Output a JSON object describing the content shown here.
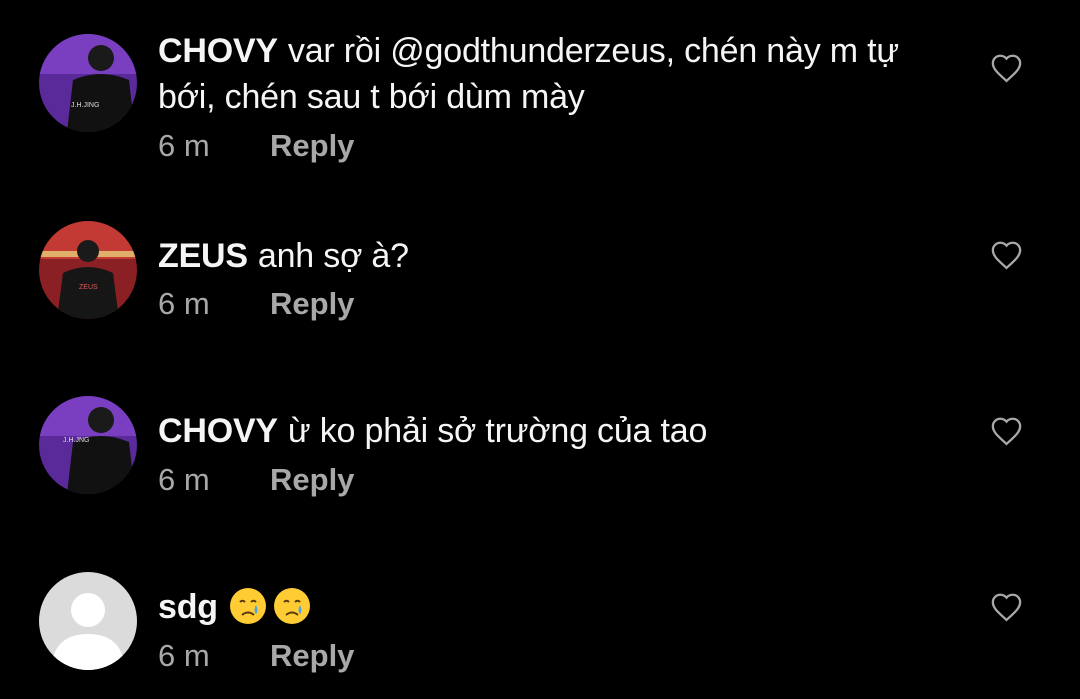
{
  "comments": [
    {
      "username": "CHOVY",
      "text": "var rồi @godthunderzeus, chén này m tự bới, chén sau t bới dùm mày",
      "time": "6 m",
      "reply_label": "Reply",
      "avatar": "chovy-avatar",
      "jersey_text": "J.H.JING"
    },
    {
      "username": "ZEUS",
      "text": "anh sợ à?",
      "time": "6 m",
      "reply_label": "Reply",
      "avatar": "zeus-avatar",
      "jersey_text": "ZEUS"
    },
    {
      "username": "CHOVY",
      "text": "ừ ko phải sở trường của tao",
      "time": "6 m",
      "reply_label": "Reply",
      "avatar": "chovy-avatar",
      "jersey_text": "J.H.JNG"
    },
    {
      "username": "sdg",
      "text": "",
      "emojis": [
        "crying-face-emoji",
        "crying-face-emoji"
      ],
      "time": "6 m",
      "reply_label": "Reply",
      "avatar": "default-avatar"
    }
  ],
  "icons": {
    "like": "heart-outline-icon"
  },
  "colors": {
    "background": "#000000",
    "text": "#f5f5f5",
    "secondary_text": "#a8a8a8",
    "chovy_avatar_bg": "#5b2a9a",
    "zeus_avatar_bg": "#b22b2b",
    "default_avatar_bg": "#dbdbdb"
  }
}
